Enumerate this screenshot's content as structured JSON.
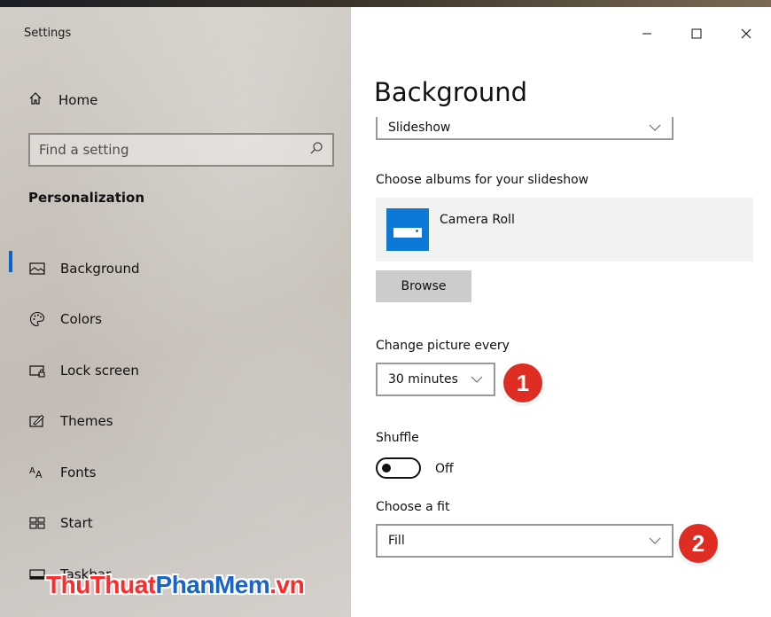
{
  "app": {
    "title": "Settings"
  },
  "window_controls": {
    "minimize": "—",
    "maximize": "☐",
    "close": "✕"
  },
  "sidebar": {
    "home_label": "Home",
    "search_placeholder": "Find a setting",
    "section_title": "Personalization",
    "items": [
      {
        "label": "Background",
        "icon": "background-icon",
        "active": true
      },
      {
        "label": "Colors",
        "icon": "palette-icon",
        "active": false
      },
      {
        "label": "Lock screen",
        "icon": "lock-screen-icon",
        "active": false
      },
      {
        "label": "Themes",
        "icon": "themes-icon",
        "active": false
      },
      {
        "label": "Fonts",
        "icon": "fonts-icon",
        "active": false
      },
      {
        "label": "Start",
        "icon": "start-icon",
        "active": false
      },
      {
        "label": "Taskbar",
        "icon": "taskbar-icon",
        "active": false
      }
    ]
  },
  "watermark": {
    "part1": "ThuThuat",
    "part2": "PhanMem",
    "part3": ".vn"
  },
  "main": {
    "title": "Background",
    "background_type": "Slideshow",
    "albums_label": "Choose albums for your slideshow",
    "album_name": "Camera Roll",
    "browse_label": "Browse",
    "change_label": "Change picture every",
    "change_value": "30 minutes",
    "shuffle_label": "Shuffle",
    "shuffle_state": "Off",
    "fit_label": "Choose a fit",
    "fit_value": "Fill"
  },
  "annotations": {
    "badge1": "1",
    "badge2": "2"
  },
  "colors": {
    "accent": "#0a63c9",
    "badge": "#e02d24",
    "album_tile": "#0d78d6"
  }
}
